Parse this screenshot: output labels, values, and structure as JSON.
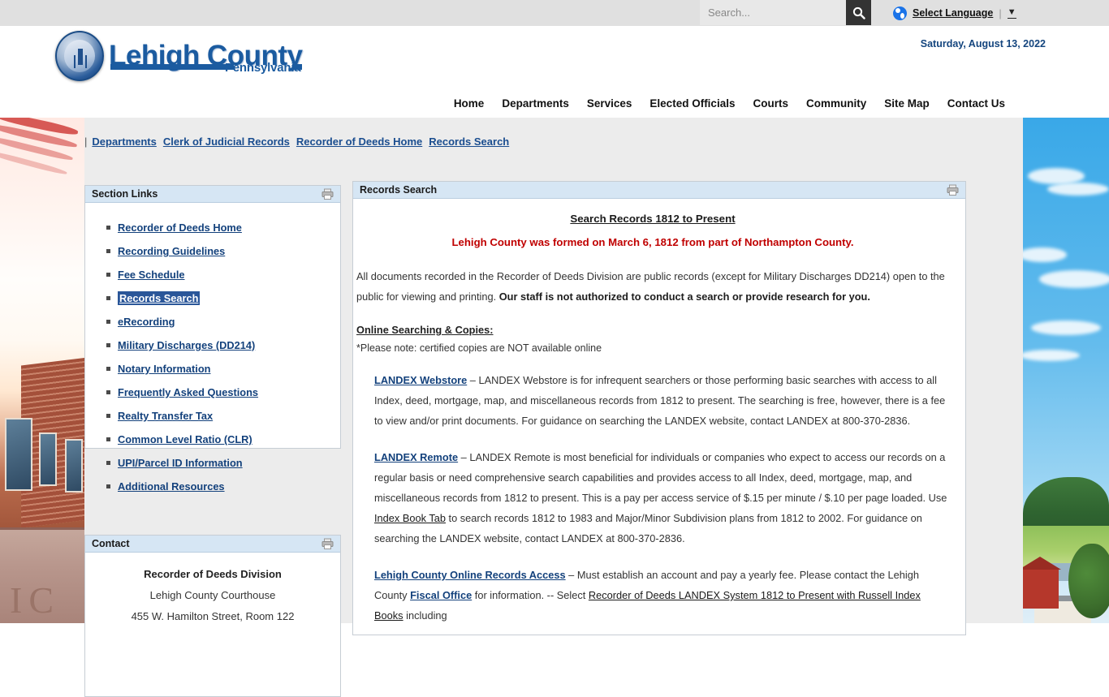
{
  "topbar": {
    "search_placeholder": "Search...",
    "search_value": "",
    "search_icon": "search-icon",
    "language_label": "Select Language",
    "language_divider": "|",
    "language_caret": "▼",
    "globe_icon": "globe-icon"
  },
  "header": {
    "logo_main": "Lehigh County",
    "logo_sub": "Pennsylvania",
    "seal_icon": "county-seal-icon",
    "date": "Saturday, August 13, 2022",
    "nav": [
      "Home",
      "Departments",
      "Services",
      "Elected Officials",
      "Courts",
      "Community",
      "Site Map",
      "Contact Us"
    ]
  },
  "breadcrumb": {
    "prefix": "|",
    "items": [
      "Departments",
      "Clerk of Judicial Records",
      "Recorder of Deeds Home",
      "Records Search"
    ]
  },
  "sidebar": {
    "section_links": {
      "title": "Section Links",
      "print_icon": "print-icon",
      "items": [
        {
          "label": "Recorder of Deeds Home",
          "selected": false
        },
        {
          "label": "Recording Guidelines",
          "selected": false
        },
        {
          "label": "Fee Schedule",
          "selected": false
        },
        {
          "label": "Records Search",
          "selected": true
        },
        {
          "label": "eRecording",
          "selected": false
        },
        {
          "label": "Military Discharges (DD214)",
          "selected": false
        },
        {
          "label": "Notary Information",
          "selected": false
        },
        {
          "label": "Frequently Asked Questions",
          "selected": false
        },
        {
          "label": "Realty Transfer Tax",
          "selected": false
        },
        {
          "label": "Common Level Ratio (CLR)",
          "selected": false
        },
        {
          "label": "UPI/Parcel ID Information",
          "selected": false
        },
        {
          "label": "Additional Resources",
          "selected": false
        }
      ]
    },
    "contact": {
      "title": "Contact",
      "print_icon": "print-icon",
      "lines": [
        "Recorder of Deeds Division",
        "Lehigh County Courthouse",
        "455 W. Hamilton Street, Room 122"
      ]
    }
  },
  "main": {
    "title": "Records Search",
    "print_icon": "print-icon",
    "heading": "Search Records 1812 to Present",
    "notice": "Lehigh County was formed on March 6, 1812 from part of Northampton County.",
    "intro_a": "All documents recorded in the Recorder of Deeds Division are public records (except for Military Discharges DD214) open to the public for viewing and printing.  ",
    "intro_b": "Our staff is not authorized to conduct a search or provide research for you.",
    "online_heading": "Online Searching & Copies:",
    "online_note": "*Please note: certified copies are NOT available online",
    "webstore_link": "LANDEX Webstore",
    "webstore_text": " – LANDEX Webstore is for infrequent searchers or those performing basic searches with access to all Index, deed, mortgage, map, and miscellaneous records from 1812 to present.  The searching is free, however, there is a fee to view and/or print documents.  For guidance on searching the LANDEX website, contact LANDEX at 800-370-2836.",
    "remote_link": "LANDEX Remote",
    "remote_text_1": " – LANDEX Remote is most beneficial for individuals or companies who expect to access our records on a regular basis or need comprehensive search capabilities and provides access to all Index, deed, mortgage, map, and miscellaneous records from 1812 to present.  This is a pay per access service of $.15 per minute / $.10 per page loaded.  Use ",
    "remote_index_link": "Index Book Tab",
    "remote_text_2": " to search records 1812 to 1983 and Major/Minor Subdivision plans from 1812 to 2002. For guidance on searching the LANDEX website, contact LANDEX at 800-370-2836.",
    "online_access_link": "Lehigh County Online Records Access",
    "online_access_text_1": " – Must establish an account and pay a yearly fee.  Please contact the Lehigh County ",
    "fiscal_office_link": "Fiscal Office",
    "online_access_text_2": " for information. -- Select ",
    "russell_link": "Recorder of Deeds LANDEX System 1812 to Present with Russell Index Books",
    "online_access_text_3": " including"
  },
  "colors": {
    "accent_blue": "#1b5ba0",
    "link_blue": "#13417c",
    "panel_header": "#d6e6f4",
    "selected_bg": "#2a5699",
    "notice_red": "#c00000",
    "page_bg": "#ececec"
  }
}
